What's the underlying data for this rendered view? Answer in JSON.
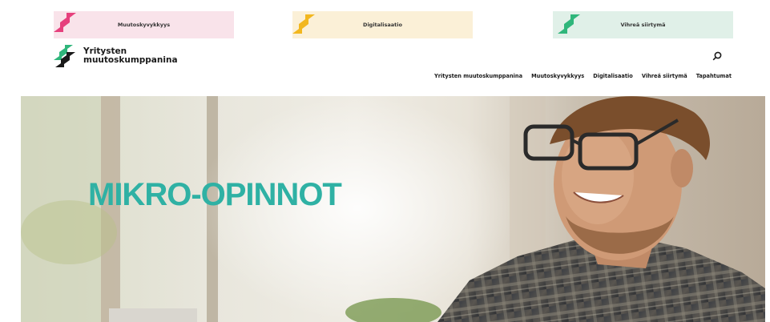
{
  "themes": [
    {
      "label": "Muutoskyvykkyys",
      "color": "#e6407d"
    },
    {
      "label": "Digitalisaatio",
      "color": "#f2b71f"
    },
    {
      "label": "Vihreä siirtymä",
      "color": "#2fb67b"
    }
  ],
  "logo": {
    "line1": "Yritysten",
    "line2": "muutoskumppanina"
  },
  "nav": {
    "items": [
      "Yritysten muutoskumppanina",
      "Muutoskyvykkyys",
      "Digitalisaatio",
      "Vihreä siirtymä",
      "Tapahtumat"
    ]
  },
  "hero": {
    "title": "MIKRO-OPINNOT"
  },
  "colors": {
    "accent": "#2fb1a4"
  }
}
